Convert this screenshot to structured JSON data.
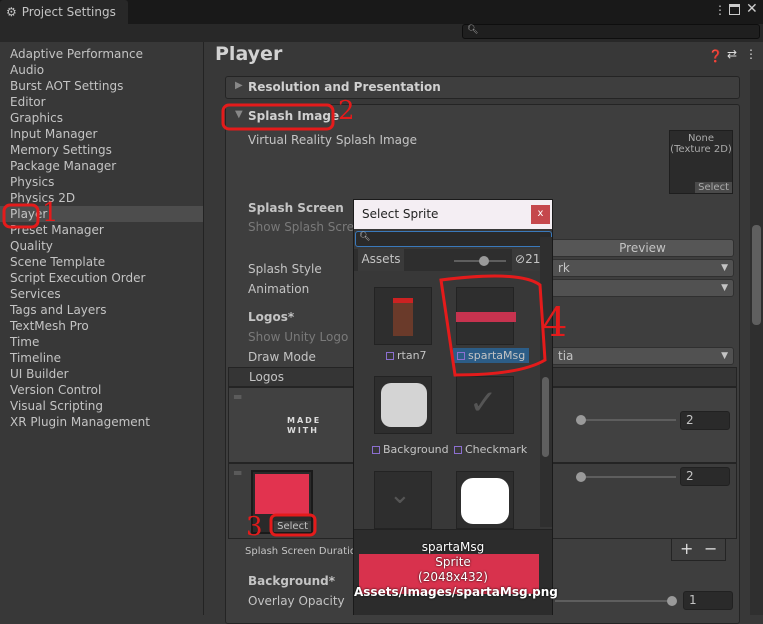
{
  "window": {
    "tab_title": "Project Settings",
    "search_placeholder": ""
  },
  "sidebar": {
    "items": [
      {
        "label": "Adaptive Performance"
      },
      {
        "label": "Audio"
      },
      {
        "label": "Burst AOT Settings"
      },
      {
        "label": "Editor"
      },
      {
        "label": "Graphics"
      },
      {
        "label": "Input Manager"
      },
      {
        "label": "Memory Settings"
      },
      {
        "label": "Package Manager"
      },
      {
        "label": "Physics"
      },
      {
        "label": "Physics 2D"
      },
      {
        "label": "Player",
        "selected": true
      },
      {
        "label": "Preset Manager"
      },
      {
        "label": "Quality"
      },
      {
        "label": "Scene Template"
      },
      {
        "label": "Script Execution Order"
      },
      {
        "label": "Services"
      },
      {
        "label": "Tags and Layers"
      },
      {
        "label": "TextMesh Pro"
      },
      {
        "label": "Time"
      },
      {
        "label": "Timeline"
      },
      {
        "label": "UI Builder"
      },
      {
        "label": "Version Control"
      },
      {
        "label": "Visual Scripting"
      },
      {
        "label": "XR Plugin Management"
      }
    ]
  },
  "main": {
    "title": "Player",
    "resolution_header": "Resolution and Presentation",
    "splash_header": "Splash Image",
    "vr_splash_label": "Virtual Reality Splash Image",
    "vr_splash_value": "None\n(Texture 2D)",
    "select_label": "Select",
    "splash_screen_label": "Splash Screen",
    "show_splash_label": "Show Splash Screen",
    "preview_label": "Preview",
    "splash_style_label": "Splash Style",
    "splash_style_value": "rk",
    "animation_label": "Animation",
    "animation_value": "",
    "logos_label": "Logos*",
    "show_unity_logo_label": "Show Unity Logo",
    "draw_mode_label": "Draw Mode",
    "draw_mode_value": "tia",
    "logos_list_header": "Logos",
    "made_with_text": "MADE\nWITH",
    "logo1_duration": "2",
    "logo2_duration": "2",
    "logo2_select": "Select",
    "duration_label": "Splash Screen Duration",
    "add_label": "+",
    "remove_label": "−",
    "background_label": "Background*",
    "overlay_label": "Overlay Opacity",
    "overlay_value": "1"
  },
  "popup": {
    "title": "Select Sprite",
    "close": "x",
    "search_value": "",
    "tab_assets": "Assets",
    "hidden_count": "21",
    "items": [
      {
        "name": "rtan7"
      },
      {
        "name": "spartaMsg",
        "selected": true
      },
      {
        "name": "Background"
      },
      {
        "name": "Checkmark"
      }
    ],
    "preview": {
      "name": "spartaMsg",
      "type": "Sprite",
      "size": "(2048x432)",
      "path": "Assets/Images/spartaMsg.png"
    }
  },
  "annotations": [
    "1",
    "2",
    "3",
    "4"
  ],
  "colors": {
    "accent_selected": "#2c5d87",
    "annotation": "#e41b1b",
    "close": "#c5474c",
    "sprite": "#e2334f"
  }
}
